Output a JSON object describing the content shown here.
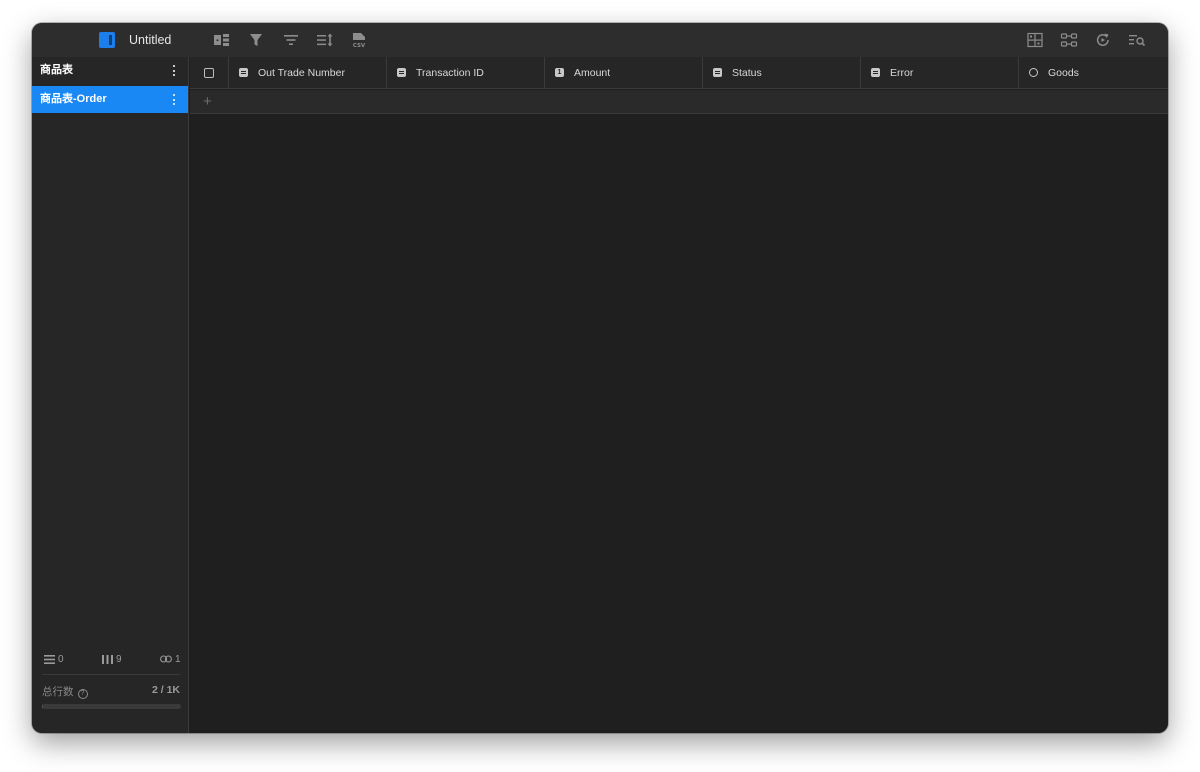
{
  "window": {
    "title": "Untitled"
  },
  "toolbar": {
    "left_icons": [
      "add-record-icon",
      "filter-icon",
      "sort-icon",
      "row-height-icon",
      "csv-export-icon"
    ],
    "right_icons": [
      "layout-icon",
      "fields-icon",
      "refresh-icon",
      "search-icon"
    ]
  },
  "sidebar": {
    "tables": [
      {
        "label": "商品表",
        "active": false
      },
      {
        "label": "商品表-Order",
        "active": true
      }
    ],
    "stats": {
      "records": "0",
      "fields": "9",
      "links": "1"
    },
    "row_count_label": "总行数",
    "row_count_value": "2 / 1K",
    "row_count_progress": 0.002
  },
  "grid": {
    "columns": [
      {
        "label": "Out Trade Number",
        "icon": "text-field-icon"
      },
      {
        "label": "Transaction ID",
        "icon": "text-field-icon"
      },
      {
        "label": "Amount",
        "icon": "number-field-icon"
      },
      {
        "label": "Status",
        "icon": "text-field-icon"
      },
      {
        "label": "Error",
        "icon": "text-field-icon"
      },
      {
        "label": "Goods",
        "icon": "link-field-icon"
      }
    ],
    "add_row_symbol": "+"
  },
  "colors": {
    "accent": "#1a88f4",
    "background": "#1f1f1f",
    "panel": "#262626",
    "toolbar": "#2d2d2d"
  }
}
